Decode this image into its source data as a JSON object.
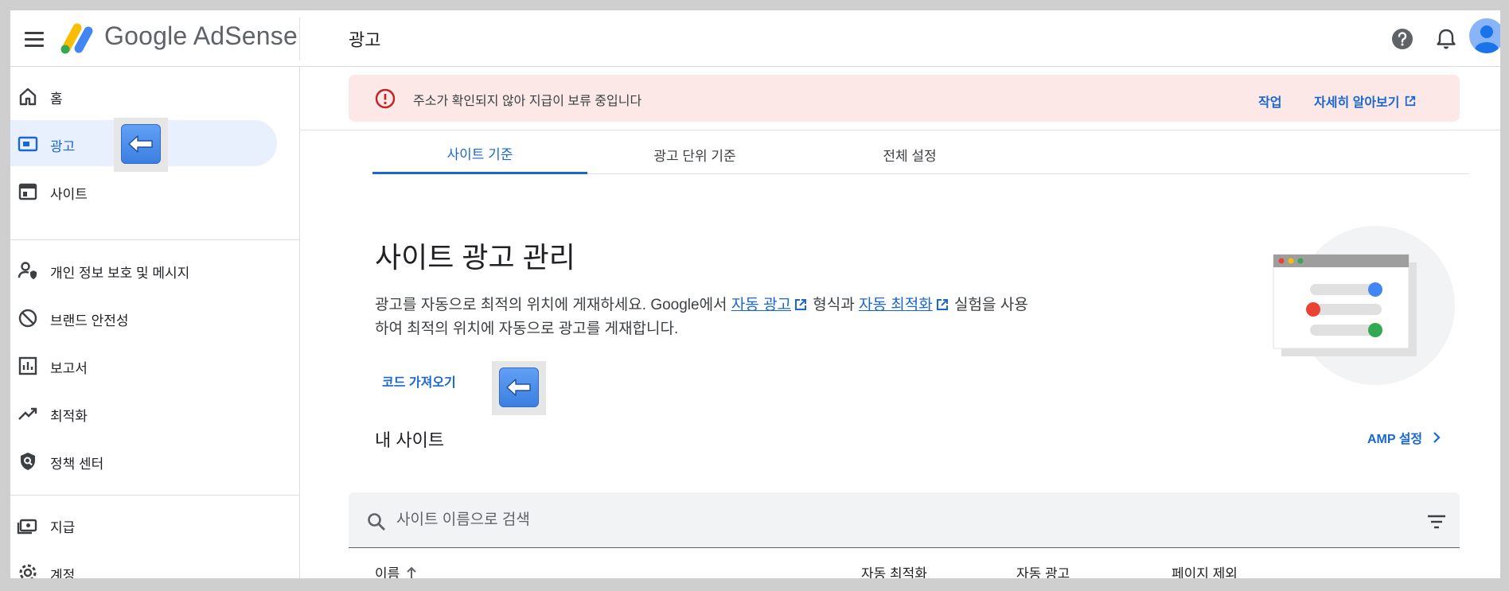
{
  "header": {
    "brand": "Google AdSense",
    "page_title": "광고"
  },
  "sidebar": {
    "items": [
      {
        "label": "홈",
        "icon": "home-icon"
      },
      {
        "label": "광고",
        "icon": "ads-icon",
        "active": true
      },
      {
        "label": "사이트",
        "icon": "sites-icon"
      },
      {
        "label": "개인 정보 보호 및 메시지",
        "icon": "privacy-icon"
      },
      {
        "label": "브랜드 안전성",
        "icon": "block-icon"
      },
      {
        "label": "보고서",
        "icon": "reports-icon"
      },
      {
        "label": "최적화",
        "icon": "trending-icon"
      },
      {
        "label": "정책 센터",
        "icon": "policy-shield-icon"
      },
      {
        "label": "지급",
        "icon": "payments-icon"
      },
      {
        "label": "계정",
        "icon": "gear-icon"
      }
    ]
  },
  "alert": {
    "message": "주소가 확인되지 않아 지급이 보류 중입니다",
    "action_label": "작업",
    "learn_more_label": "자세히 알아보기"
  },
  "tabs": [
    {
      "label": "사이트 기준",
      "active": true
    },
    {
      "label": "광고 단위 기준"
    },
    {
      "label": "전체 설정"
    }
  ],
  "main": {
    "title": "사이트 광고 관리",
    "desc_part1": "광고를 자동으로 최적의 위치에 게재하세요. Google에서 ",
    "link_auto_ads": "자동 광고",
    "desc_part2": " 형식과 ",
    "link_auto_opt": "자동 최적화",
    "desc_part3": " 실험을 사용하여 최적의 위치에 자동으로 광고를 게재합니다.",
    "code_button": "코드 가져오기",
    "my_sites": "내 사이트",
    "amp_settings": "AMP 설정"
  },
  "search": {
    "placeholder": "사이트 이름으로 검색"
  },
  "table": {
    "columns": [
      "이름",
      "자동 최적화",
      "자동 광고",
      "페이지 제외"
    ]
  },
  "colors": {
    "accent": "#1967d2",
    "alert_bg": "#fce8e6",
    "alert_icon": "#c5221f",
    "active_bg": "#e8f0fe"
  }
}
